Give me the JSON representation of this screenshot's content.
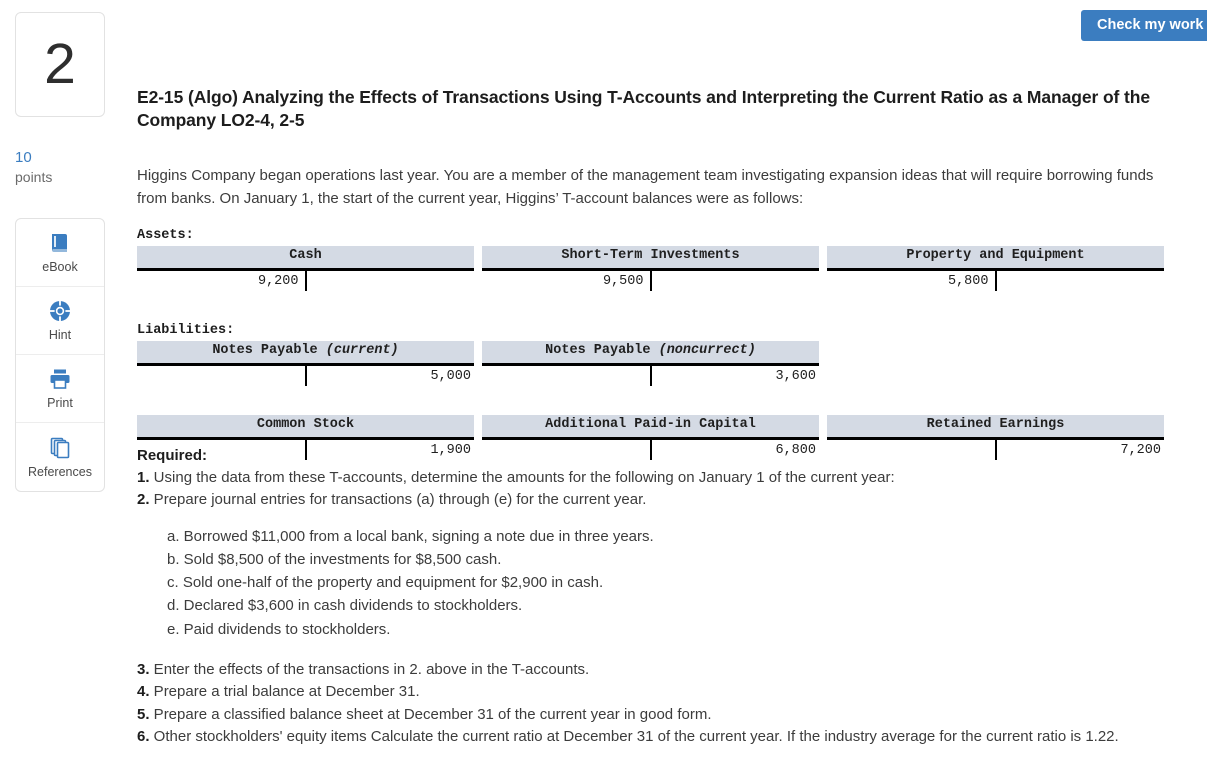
{
  "topbar": {
    "check_my_work_label": "Check my work"
  },
  "sidebar": {
    "question_number": "2",
    "points_value": "10",
    "points_label": "points",
    "tools": [
      {
        "name": "ebook",
        "label": "eBook",
        "icon": "book-icon"
      },
      {
        "name": "hint",
        "label": "Hint",
        "icon": "lifesaver-icon"
      },
      {
        "name": "print",
        "label": "Print",
        "icon": "printer-icon"
      },
      {
        "name": "references",
        "label": "References",
        "icon": "copy-pages-icon"
      }
    ]
  },
  "question": {
    "title": "E2-15 (Algo) Analyzing the Effects of Transactions Using T-Accounts and Interpreting the Current Ratio as a Manager of the Company LO2-4, 2-5",
    "intro": "Higgins Company began operations last year. You are a member of the management team investigating expansion ideas that will require borrowing funds from banks. On January 1, the start of the current year, Higgins’ T-account balances were as follows:"
  },
  "taccounts": {
    "assets_label": "Assets:",
    "liabilities_label": "Liabilities:",
    "assets": [
      {
        "title": "Cash",
        "title_italic": "",
        "debit": "9,200",
        "credit": ""
      },
      {
        "title": "Short-Term Investments",
        "title_italic": "",
        "debit": "9,500",
        "credit": ""
      },
      {
        "title": "Property and Equipment",
        "title_italic": "",
        "debit": "5,800",
        "credit": ""
      }
    ],
    "liabilities": [
      {
        "title": "Notes Payable ",
        "title_italic": "(current)",
        "debit": "",
        "credit": "5,000"
      },
      {
        "title": "Notes Payable ",
        "title_italic": "(noncurrect)",
        "debit": "",
        "credit": "3,600"
      }
    ],
    "equity": [
      {
        "title": "Common Stock",
        "title_italic": "",
        "debit": "",
        "credit": "1,900"
      },
      {
        "title": "Additional Paid-in Capital",
        "title_italic": "",
        "debit": "",
        "credit": "6,800"
      },
      {
        "title": "Retained Earnings",
        "title_italic": "",
        "debit": "",
        "credit": "7,200"
      }
    ]
  },
  "required": {
    "heading": "Required:",
    "item1_num": "1.",
    "item1_text": " Using the data from these T-accounts, determine the amounts for the following on January 1 of the current year:",
    "item2_num": "2.",
    "item2_text": " Prepare journal entries for transactions (a) through (e) for the current year.",
    "transactions": [
      "a. Borrowed $11,000 from a local bank, signing a note due in three years.",
      "b. Sold $8,500 of the investments for $8,500 cash.",
      "c. Sold one-half of the property and equipment for $2,900 in cash.",
      "d. Declared $3,600 in cash dividends to stockholders.",
      "e. Paid dividends to stockholders."
    ],
    "item3_num": "3.",
    "item3_text": " Enter the effects of the transactions in 2. above in the T-accounts.",
    "item4_num": "4.",
    "item4_text": " Prepare a trial balance at December 31.",
    "item5_num": "5.",
    "item5_text": " Prepare a classified balance sheet at December 31 of the current year in good form.",
    "item6_num": "6.",
    "item6_text": " Other stockholders' equity items Calculate the current ratio at December 31 of the current year. If the industry average for the current ratio is 1.22."
  },
  "colors": {
    "accent_blue": "#3B7DC0",
    "taccount_header_bg": "#d4dae4",
    "body_text": "#3c3c3c"
  }
}
